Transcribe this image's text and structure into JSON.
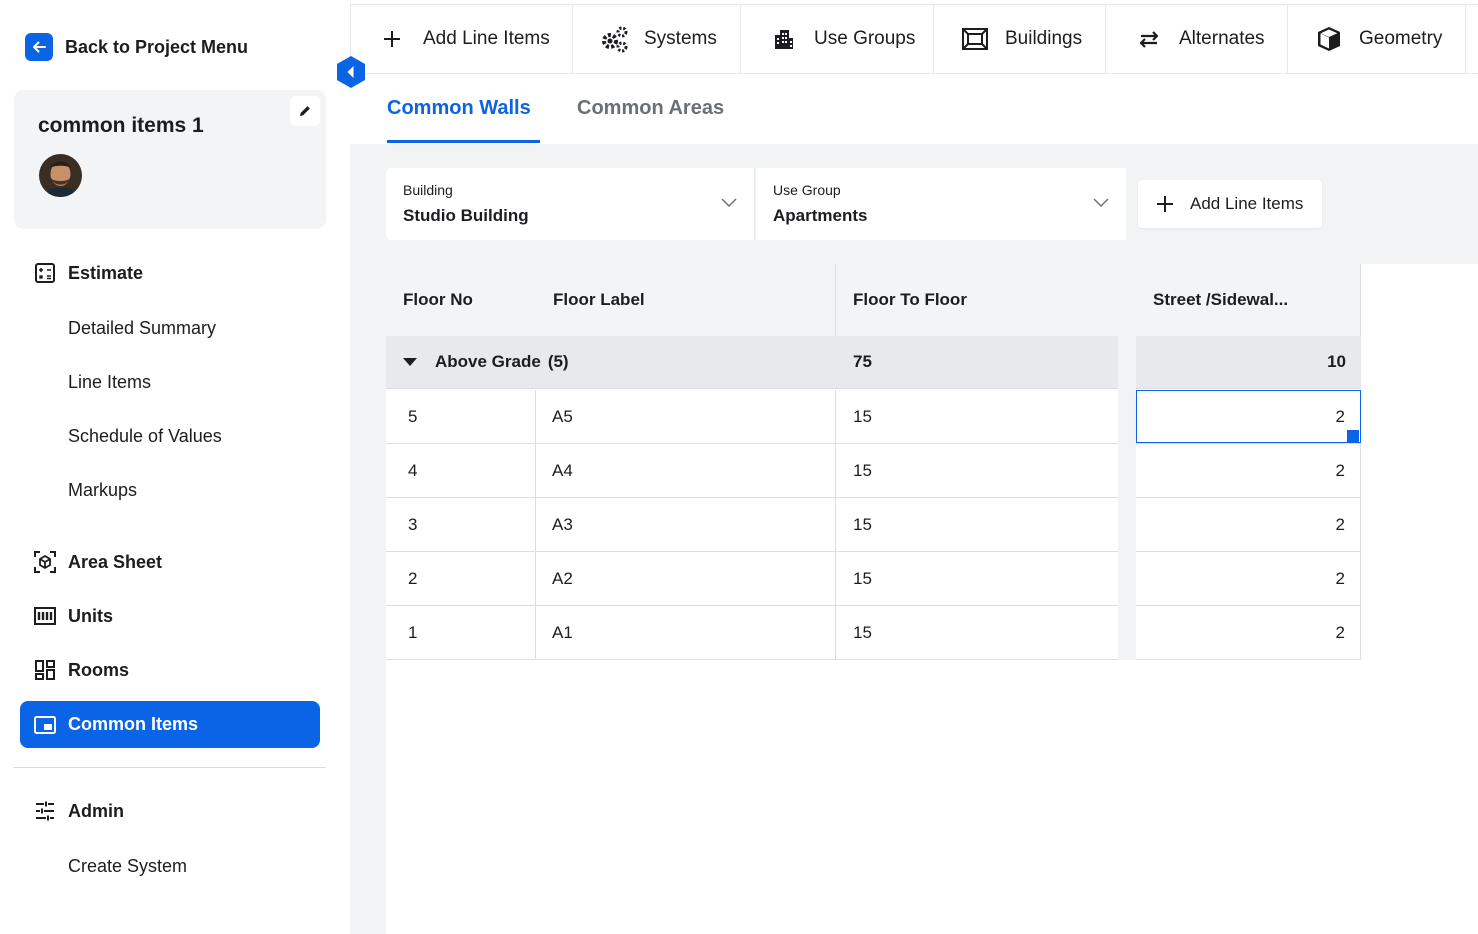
{
  "sidebar": {
    "back_label": "Back to Project Menu",
    "project_title": "common items 1",
    "nav": {
      "estimate": "Estimate",
      "detailed_summary": "Detailed Summary",
      "line_items": "Line Items",
      "schedule_of_values": "Schedule of Values",
      "markups": "Markups",
      "area_sheet": "Area Sheet",
      "units": "Units",
      "rooms": "Rooms",
      "common_items": "Common Items",
      "admin": "Admin",
      "create_system": "Create System"
    }
  },
  "toolbar": {
    "add_line_items": "Add Line Items",
    "systems": "Systems",
    "use_groups": "Use Groups",
    "buildings": "Buildings",
    "alternates": "Alternates",
    "geometry": "Geometry"
  },
  "tabs": {
    "common_walls": "Common Walls",
    "common_areas": "Common Areas"
  },
  "filters": {
    "building_caption": "Building",
    "building_value": "Studio Building",
    "use_group_caption": "Use Group",
    "use_group_value": "Apartments",
    "add_line_items": "Add Line Items"
  },
  "table": {
    "headers": {
      "floor_no": "Floor No",
      "floor_label": "Floor Label",
      "floor_to_floor": "Floor To Floor",
      "street_sidewalk": "Street /Sidewal..."
    },
    "group": {
      "label": "Above Grade",
      "count": "(5)",
      "floor_to_floor_total": "75",
      "street_sidewalk_total": "10"
    },
    "rows": [
      {
        "floor_no": "5",
        "floor_label": "A5",
        "floor_to_floor": "15",
        "street_sidewalk": "2"
      },
      {
        "floor_no": "4",
        "floor_label": "A4",
        "floor_to_floor": "15",
        "street_sidewalk": "2"
      },
      {
        "floor_no": "3",
        "floor_label": "A3",
        "floor_to_floor": "15",
        "street_sidewalk": "2"
      },
      {
        "floor_no": "2",
        "floor_label": "A2",
        "floor_to_floor": "15",
        "street_sidewalk": "2"
      },
      {
        "floor_no": "1",
        "floor_label": "A1",
        "floor_to_floor": "15",
        "street_sidewalk": "2"
      }
    ]
  },
  "colors": {
    "accent": "#0b63e5",
    "header_bg": "#f3f4f6",
    "group_bg": "#e8e9ec"
  },
  "icons": {
    "back": "arrow-left-icon",
    "edit": "pencil-icon",
    "collapse": "chevron-left-icon",
    "estimate": "calculator-icon",
    "area_sheet": "cube-scan-icon",
    "units": "units-icon",
    "rooms": "rooms-grid-icon",
    "common_items": "common-items-icon",
    "admin": "sliders-icon",
    "systems": "gears-icon",
    "use_groups": "building-icon",
    "buildings": "frame-icon",
    "alternates": "swap-arrows-icon",
    "geometry": "box-3d-icon",
    "plus": "plus-icon",
    "group_toggle": "caret-down-icon",
    "select_chevron": "chevron-down-icon"
  }
}
